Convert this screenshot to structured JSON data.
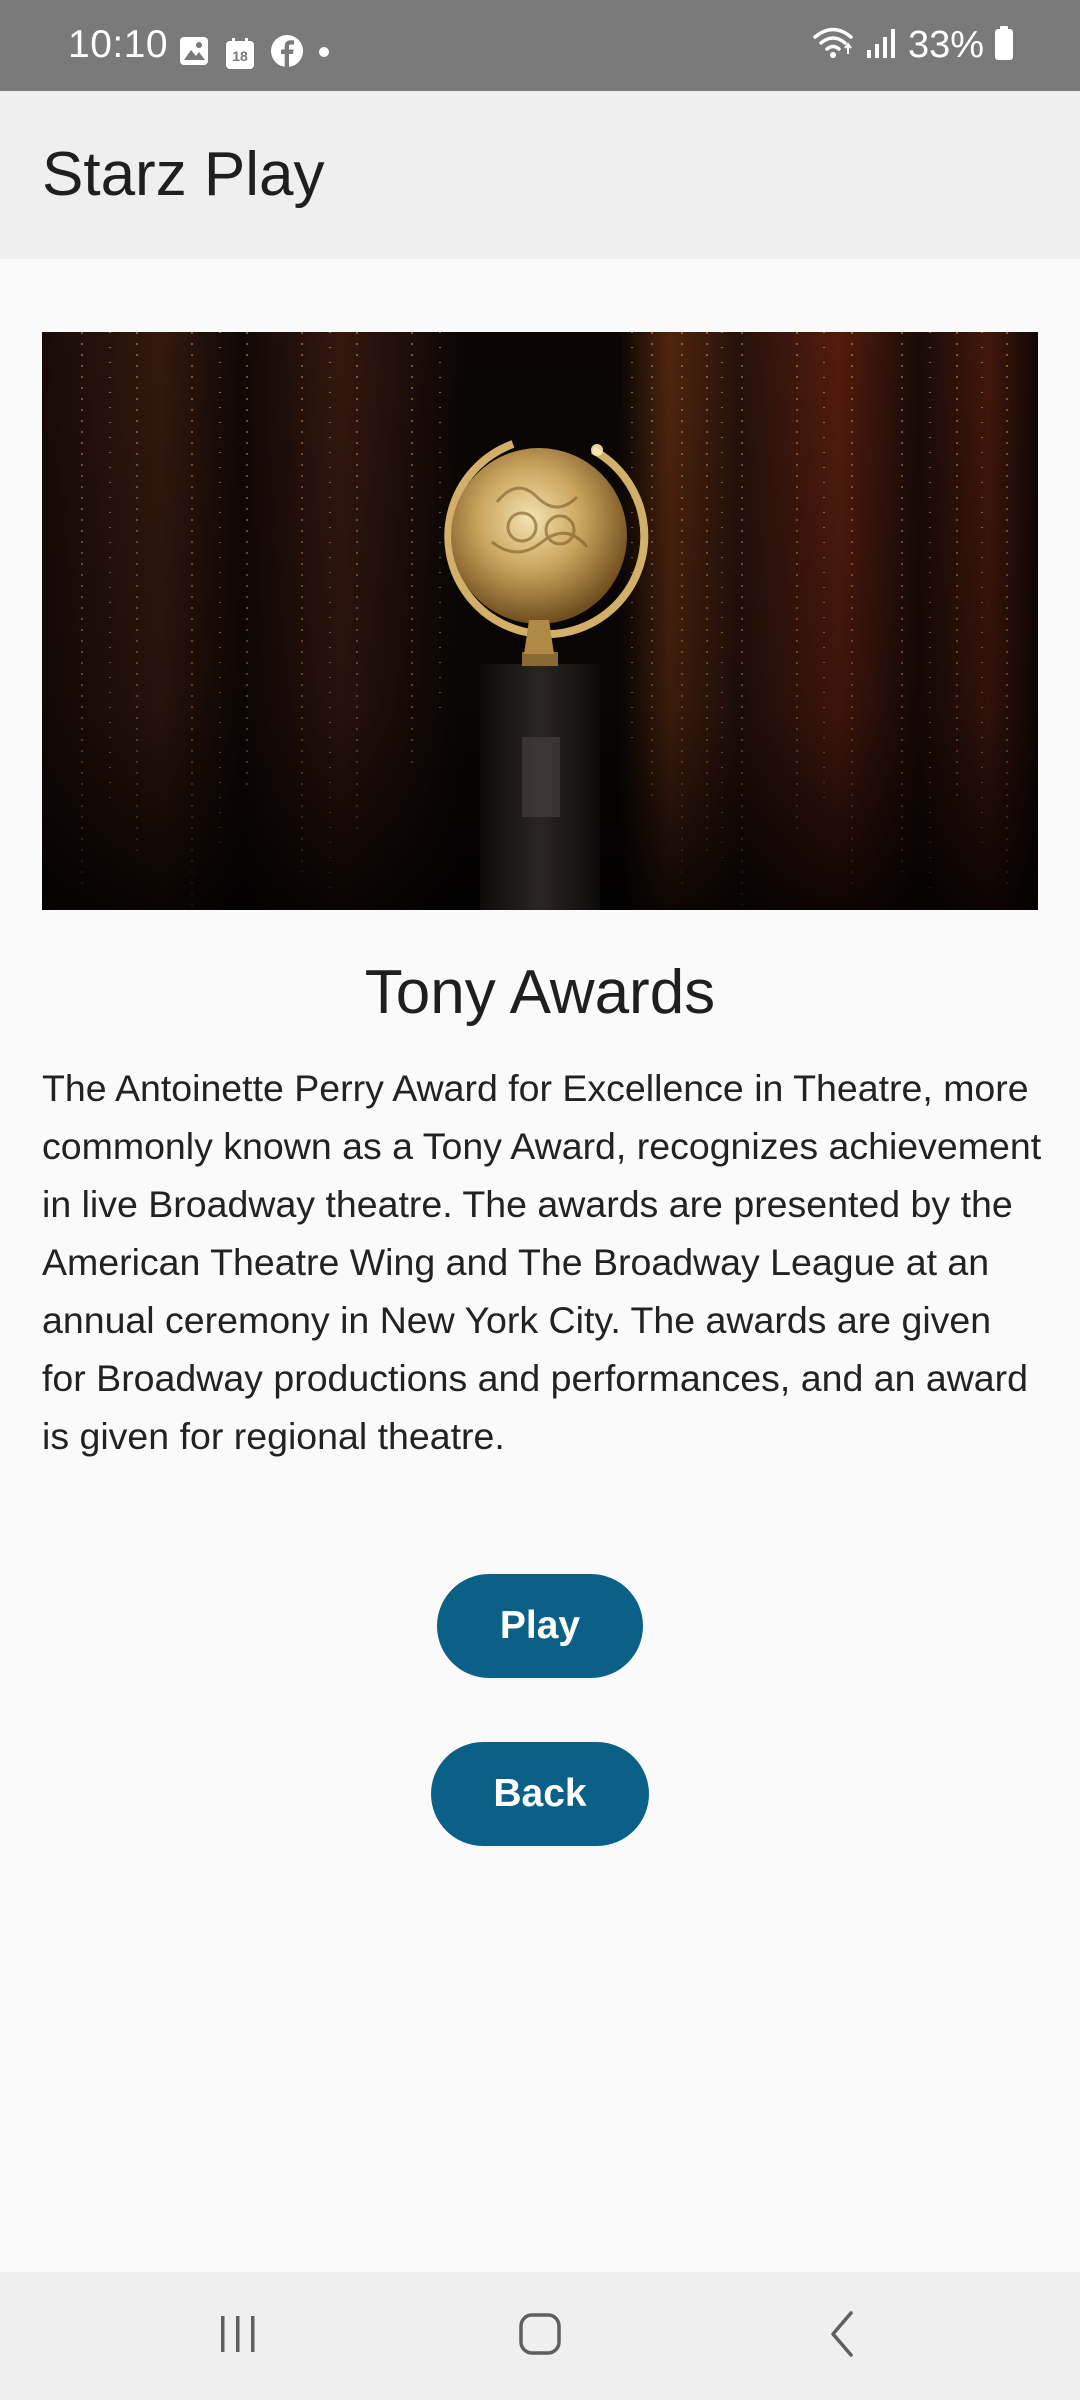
{
  "status_bar": {
    "time": "10:10",
    "calendar_day": "18",
    "battery_percent": "33%",
    "left_icons": [
      "gallery-icon",
      "calendar-icon",
      "facebook-icon",
      "dot-icon"
    ],
    "right_icons": [
      "wifi-icon",
      "signal-icon",
      "battery-icon"
    ]
  },
  "app_bar": {
    "title": "Starz Play"
  },
  "show": {
    "image_name": "tony-award-trophy-image",
    "title": "Tony Awards",
    "description": "The Antoinette Perry Award for Excellence in Theatre, more commonly known as a Tony Award, recognizes achievement in live Broadway theatre. The awards are presented by the American Theatre Wing and The Broadway League at an annual ceremony in New York City. The awards are given for Broadway productions and performances, and an award is given for regional theatre."
  },
  "actions": {
    "play_label": "Play",
    "back_label": "Back"
  },
  "nav_bar": {
    "icons": [
      "recents-icon",
      "home-icon",
      "back-icon"
    ]
  },
  "colors": {
    "status_bar": "#7a7a7a",
    "app_bar": "#efeff0",
    "background": "#fafafa",
    "button": "#0b6088",
    "button_text": "#ffffff"
  }
}
